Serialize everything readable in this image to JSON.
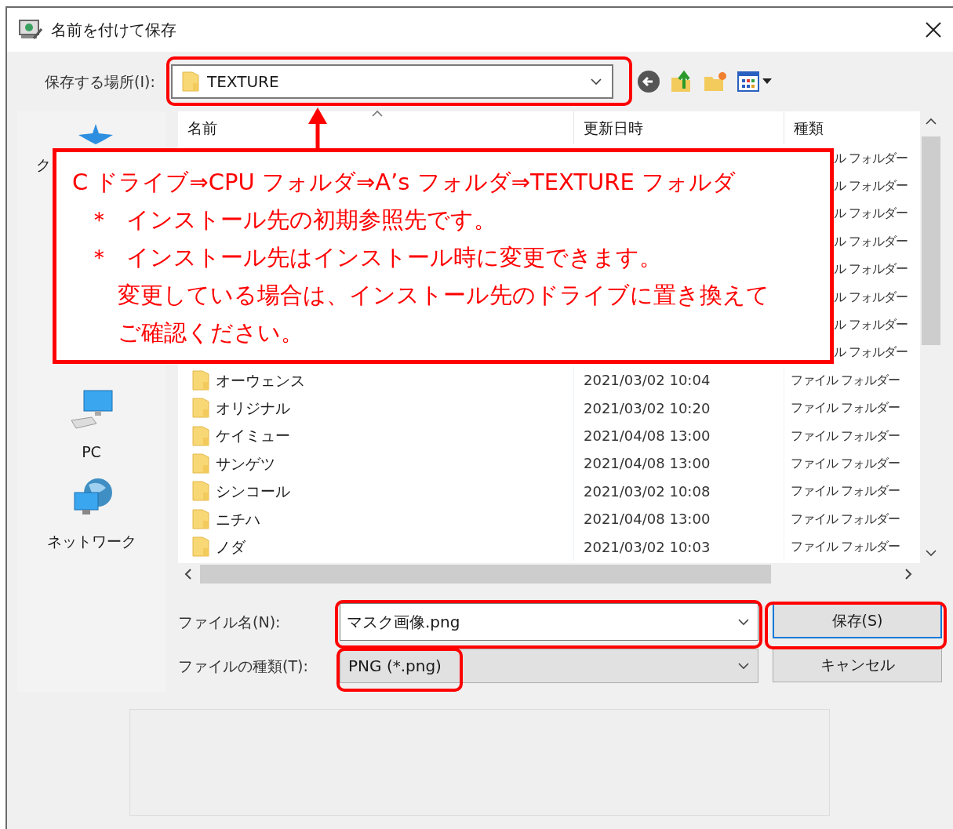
{
  "window": {
    "title": "名前を付けて保存"
  },
  "location": {
    "label": "保存する場所(I):",
    "value": "TEXTURE"
  },
  "sidebar": {
    "items": [
      {
        "label": "ク",
        "kind": "quick"
      },
      {
        "label": "PC",
        "kind": "pc"
      },
      {
        "label": "ネットワーク",
        "kind": "network"
      }
    ]
  },
  "file_list": {
    "columns": [
      "名前",
      "更新日時",
      "種類"
    ],
    "rows": [
      {
        "kind": "covered",
        "type": "ル フォルダー"
      },
      {
        "kind": "covered",
        "type": "ル フォルダー"
      },
      {
        "kind": "covered",
        "type": "ル フォルダー"
      },
      {
        "kind": "covered",
        "type": "ル フォルダー"
      },
      {
        "kind": "covered",
        "type": "ル フォルダー"
      },
      {
        "kind": "covered",
        "type": "ル フォルダー"
      },
      {
        "kind": "covered",
        "type": "ル フォルダー"
      },
      {
        "kind": "covered",
        "type": "ル フォルダー"
      },
      {
        "kind": "folder",
        "name": "オーウェンス",
        "date": "2021/03/02 10:04",
        "type": "ファイル フォルダー"
      },
      {
        "kind": "folder",
        "name": "オリジナル",
        "date": "2021/03/02 10:20",
        "type": "ファイル フォルダー"
      },
      {
        "kind": "folder",
        "name": "ケイミュー",
        "date": "2021/04/08 13:00",
        "type": "ファイル フォルダー"
      },
      {
        "kind": "folder",
        "name": "サンゲツ",
        "date": "2021/04/08 13:00",
        "type": "ファイル フォルダー"
      },
      {
        "kind": "folder",
        "name": "シンコール",
        "date": "2021/03/02 10:08",
        "type": "ファイル フォルダー"
      },
      {
        "kind": "folder",
        "name": "ニチハ",
        "date": "2021/04/08 13:00",
        "type": "ファイル フォルダー"
      },
      {
        "kind": "folder",
        "name": "ノダ",
        "date": "2021/03/02 10:03",
        "type": "ファイル フォルダー"
      }
    ]
  },
  "file_name": {
    "label": "ファイル名(N):",
    "value": "マスク画像.png"
  },
  "file_type": {
    "label": "ファイルの種類(T):",
    "value": "PNG (*.png)"
  },
  "buttons": [
    {
      "label": "保存(S)",
      "default": true
    },
    {
      "label": "キャンセル",
      "default": false
    }
  ],
  "callout": {
    "lines": [
      {
        "kind": "heading",
        "text": "C ドライブ⇒CPU フォルダ⇒A’s フォルダ⇒TEXTURE フォルダ"
      },
      {
        "kind": "bullet",
        "mark": "＊",
        "text": "インストール先の初期参照先です。"
      },
      {
        "kind": "bullet",
        "mark": "＊",
        "text": "インストール先はインストール時に変更できます。"
      },
      {
        "kind": "continued",
        "text": "変更している場合は、インストール先のドライブに置き換えて"
      },
      {
        "kind": "continued",
        "text": "ご確認ください。"
      }
    ]
  }
}
